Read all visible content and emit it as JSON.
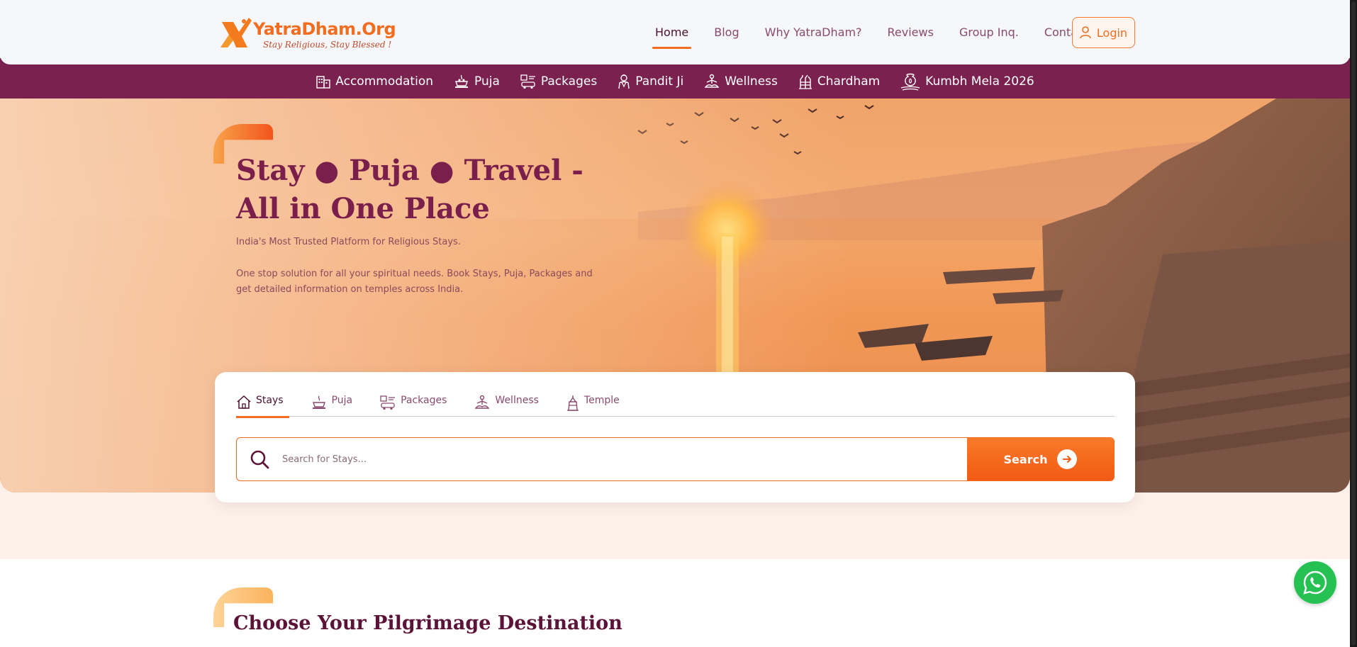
{
  "brand": {
    "name": "YatraDham.Org",
    "tagline": "Stay Religious, Stay Blessed !"
  },
  "main_nav": [
    {
      "label": "Home",
      "active": true
    },
    {
      "label": "Blog"
    },
    {
      "label": "Why YatraDham?"
    },
    {
      "label": "Reviews"
    },
    {
      "label": "Group Inq."
    },
    {
      "label": "Contact"
    }
  ],
  "login": {
    "label": "Login",
    "icon": "user-icon"
  },
  "categories": [
    {
      "label": "Accommodation",
      "icon": "building-icon"
    },
    {
      "label": "Puja",
      "icon": "puja-icon"
    },
    {
      "label": "Packages",
      "icon": "packages-icon"
    },
    {
      "label": "Pandit Ji",
      "icon": "pandit-icon"
    },
    {
      "label": "Wellness",
      "icon": "meditation-icon"
    },
    {
      "label": "Chardham",
      "icon": "chardham-icon"
    },
    {
      "label": "Kumbh Mela 2026",
      "icon": "kumbh-icon"
    }
  ],
  "hero": {
    "title_line1": "Stay ● Puja ● Travel -",
    "title_line2": "All in One Place",
    "subtitle": "India's Most Trusted Platform for Religious Stays.",
    "description": "One stop solution for all your spiritual needs. Book Stays, Puja, Packages and get detailed information on temples across India."
  },
  "search": {
    "tabs": [
      {
        "label": "Stays",
        "icon": "home-icon",
        "active": true
      },
      {
        "label": "Puja",
        "icon": "puja-icon"
      },
      {
        "label": "Packages",
        "icon": "packages-icon"
      },
      {
        "label": "Wellness",
        "icon": "meditation-icon"
      },
      {
        "label": "Temple",
        "icon": "temple-icon"
      }
    ],
    "placeholder": "Search for Stays...",
    "button_label": "Search"
  },
  "section": {
    "title": "Choose Your Pilgrimage Destination"
  },
  "colors": {
    "brand_orange": "#f26d1f",
    "brand_maroon": "#7a2150",
    "whatsapp_green": "#25c253"
  }
}
